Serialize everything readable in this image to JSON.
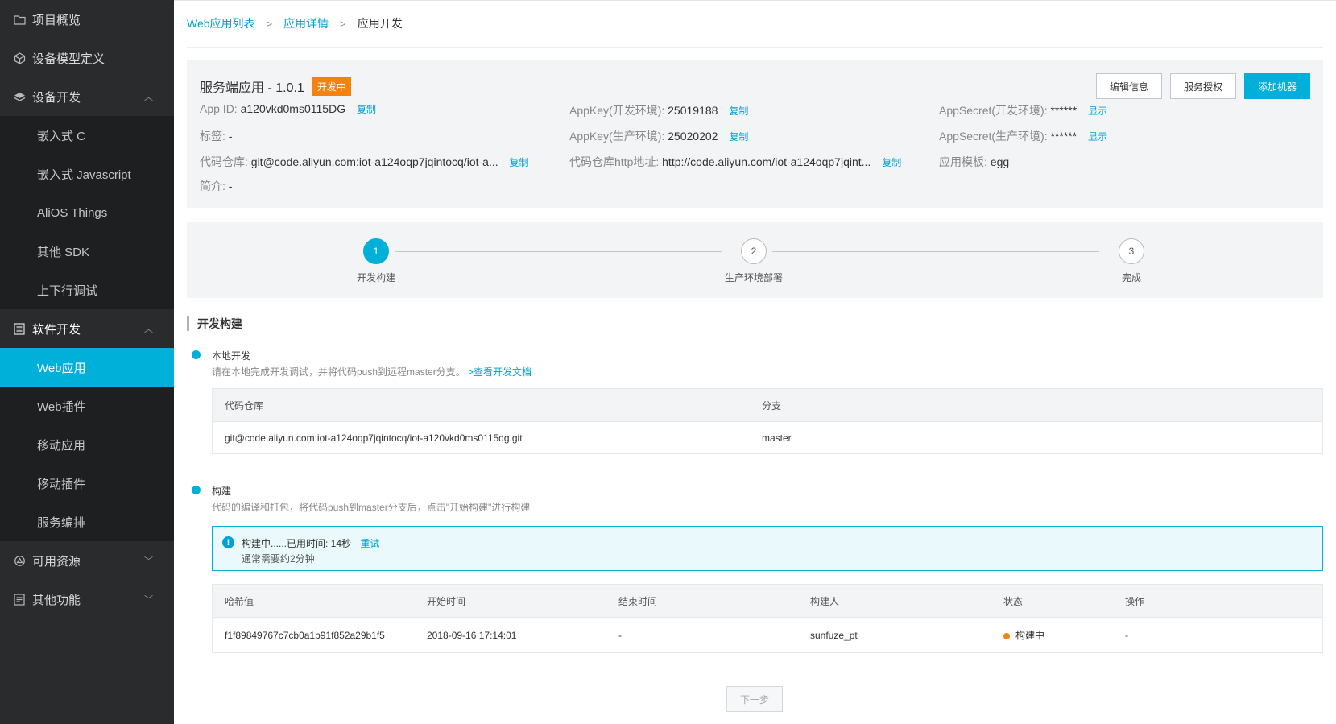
{
  "sidebar": {
    "items": [
      {
        "label": "项目概览",
        "icon": "folder-icon"
      },
      {
        "label": "设备模型定义",
        "icon": "cube-icon"
      },
      {
        "label": "设备开发",
        "icon": "layers-icon"
      },
      {
        "label": "嵌入式 C"
      },
      {
        "label": "嵌入式 Javascript"
      },
      {
        "label": "AliOS Things"
      },
      {
        "label": "其他 SDK"
      },
      {
        "label": "上下行调试"
      },
      {
        "label": "软件开发",
        "icon": "document-icon"
      },
      {
        "label": "Web应用"
      },
      {
        "label": "Web插件"
      },
      {
        "label": "移动应用"
      },
      {
        "label": "移动插件"
      },
      {
        "label": "服务编排"
      },
      {
        "label": "可用资源",
        "icon": "resource-icon"
      },
      {
        "label": "其他功能",
        "icon": "list-icon"
      }
    ]
  },
  "breadcrumb": {
    "items": [
      "Web应用列表",
      "应用详情",
      "应用开发"
    ]
  },
  "app": {
    "title": "服务端应用 - 1.0.1",
    "badge": "开发中",
    "buttons": {
      "edit": "编辑信息",
      "auth": "服务授权",
      "add": "添加机器"
    },
    "fields": {
      "app_id_label": "App ID:",
      "app_id": "a120vkd0ms0115DG",
      "tag_label": "标签:",
      "tag": "-",
      "repo_label": "代码仓库:",
      "repo": "git@code.aliyun.com:iot-a124oqp7jqintocq/iot-a...",
      "intro_label": "简介:",
      "intro": "-",
      "appkey_dev_label": "AppKey(开发环境):",
      "appkey_dev": "25019188",
      "appkey_prod_label": "AppKey(生产环境):",
      "appkey_prod": "25020202",
      "repo_http_label": "代码仓库http地址:",
      "repo_http": "http://code.aliyun.com/iot-a124oqp7jqint...",
      "secret_dev_label": "AppSecret(开发环境):",
      "secret_dev": "******",
      "secret_prod_label": "AppSecret(生产环境):",
      "secret_prod": "******",
      "template_label": "应用模板:",
      "template": "egg",
      "copy": "复制",
      "show": "显示"
    }
  },
  "steps": [
    {
      "num": "1",
      "label": "开发构建"
    },
    {
      "num": "2",
      "label": "生产环境部署"
    },
    {
      "num": "3",
      "label": "完成"
    }
  ],
  "section": {
    "title": "开发构建"
  },
  "local_dev": {
    "title": "本地开发",
    "desc": "请在本地完成开发调试，并将代码push到远程master分支。",
    "doc_link": ">查看开发文档",
    "table": {
      "headers": [
        "代码仓库",
        "分支"
      ],
      "row": [
        "git@code.aliyun.com:iot-a124oqp7jqintocq/iot-a120vkd0ms0115dg.git",
        "master"
      ]
    }
  },
  "build": {
    "title": "构建",
    "desc": "代码的编译和打包，将代码push到master分支后，点击\"开始构建\"进行构建",
    "notice": {
      "line1": "构建中......已用时间: 14秒",
      "retry": "重试",
      "line2": "通常需要约2分钟"
    },
    "table": {
      "headers": [
        "哈希值",
        "开始时间",
        "结束时间",
        "构建人",
        "状态",
        "操作"
      ],
      "row": [
        "f1f89849767c7cb0a1b91f852a29b1f5",
        "2018-09-16 17:14:01",
        "-",
        "sunfuze_pt",
        "构建中",
        "-"
      ]
    }
  },
  "next_button": "下一步"
}
